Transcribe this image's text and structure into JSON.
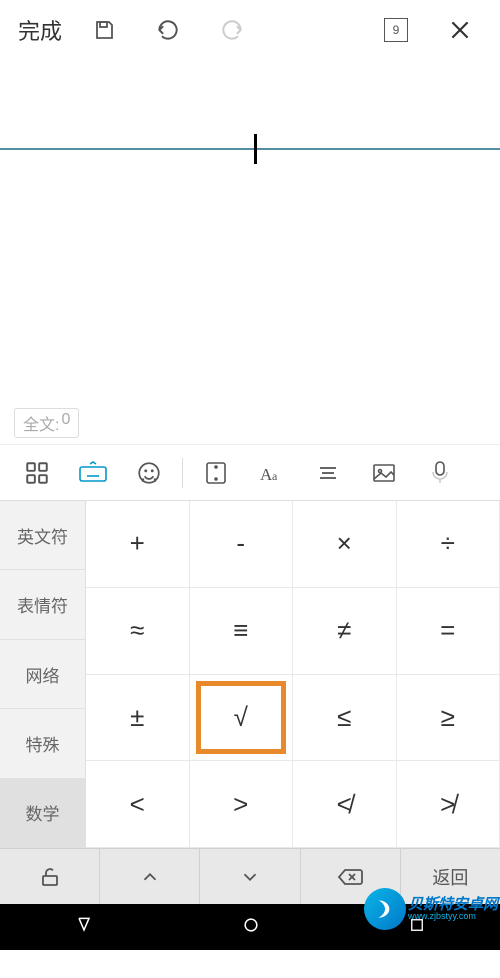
{
  "header": {
    "done_label": "完成",
    "page_number": "9"
  },
  "count_badge": {
    "prefix": "全文:",
    "value": "0"
  },
  "categories": [
    {
      "label": "英文符",
      "active": false
    },
    {
      "label": "表情符",
      "active": false
    },
    {
      "label": "网络",
      "active": false
    },
    {
      "label": "特殊",
      "active": false
    },
    {
      "label": "数学",
      "active": true
    }
  ],
  "keys": [
    {
      "sym": "+"
    },
    {
      "sym": "-"
    },
    {
      "sym": "×"
    },
    {
      "sym": "÷"
    },
    {
      "sym": "≈"
    },
    {
      "sym": "≡"
    },
    {
      "sym": "≠"
    },
    {
      "sym": "="
    },
    {
      "sym": "±"
    },
    {
      "sym": "√",
      "highlighted": true
    },
    {
      "sym": "≤"
    },
    {
      "sym": "≥"
    },
    {
      "sym": "<"
    },
    {
      "sym": ">"
    },
    {
      "sym": "≮"
    },
    {
      "sym": "≯"
    }
  ],
  "bottom_row": {
    "return_label": "返回"
  },
  "watermark": {
    "top": "贝斯特安卓网",
    "bottom": "www.zjbstyy.com"
  }
}
